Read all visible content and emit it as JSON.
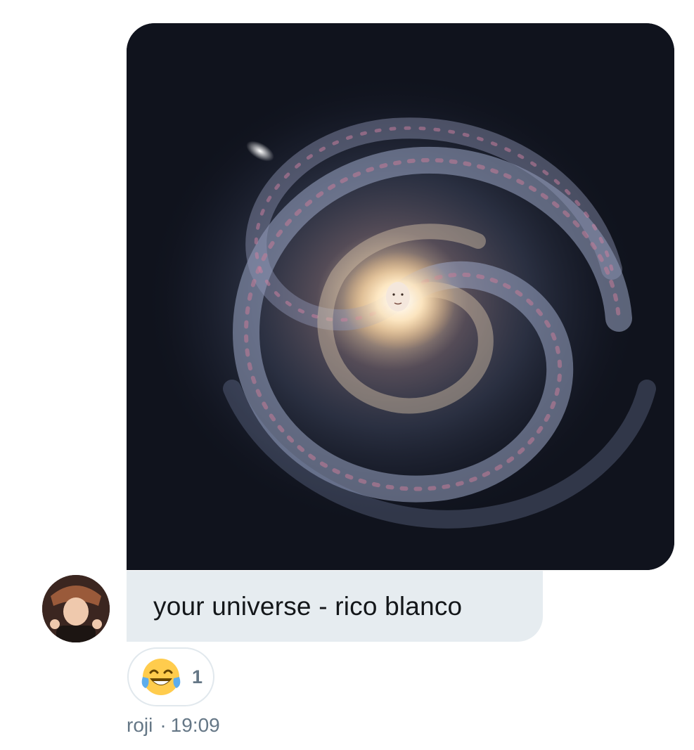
{
  "message": {
    "text": "your universe - rico blanco",
    "attachment_icon": "galaxy-image",
    "bubble_color": "#e6ecf0"
  },
  "sender": {
    "name": "roji",
    "time": "19:09",
    "separator": "·",
    "avatar_icon": "user-avatar"
  },
  "reaction": {
    "emoji_icon": "face-with-tears-of-joy-icon",
    "count": "1"
  },
  "colors": {
    "meta_text": "#657786",
    "message_text": "#14171a",
    "reaction_border": "#e1e8ed"
  }
}
